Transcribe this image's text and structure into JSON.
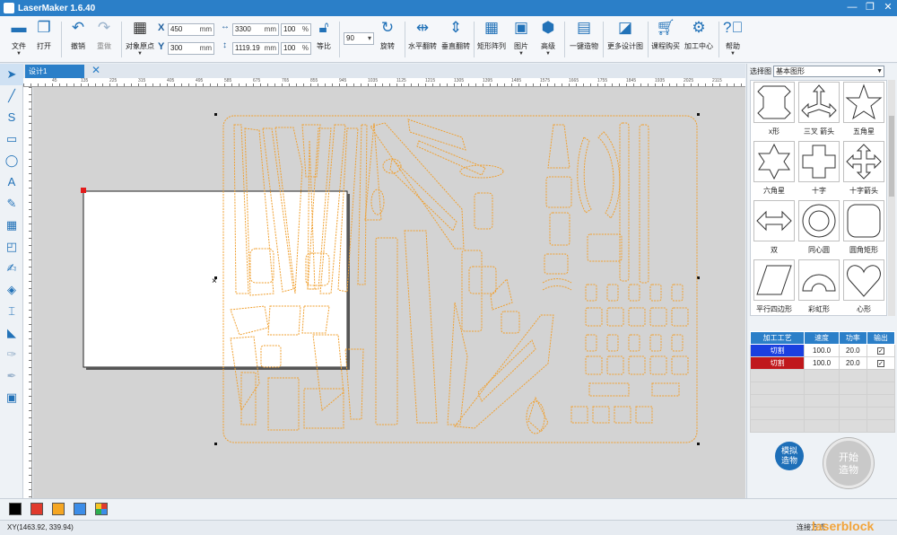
{
  "window": {
    "title": "LaserMaker 1.6.40",
    "controls": [
      "—",
      "❐",
      "✕"
    ]
  },
  "toolbar": {
    "file": "文件",
    "open": "打开",
    "undo": "撤销",
    "redo": "重做",
    "object_origin": "对象原点",
    "x_label": "X",
    "y_label": "Y",
    "x_value": "450",
    "y_value": "300",
    "width_value": "3300",
    "height_value": "1119.19",
    "unit_mm": "mm",
    "width_pct": "100",
    "height_pct": "100",
    "pct_unit": "%",
    "lock_ratio": "等比",
    "rotate_value": "90",
    "rotate": "旋转",
    "flip_h": "水平翻转",
    "flip_v": "垂直翻转",
    "matrix_array": "矩形阵列",
    "image": "图片",
    "advanced": "高级",
    "one_click": "一键造物",
    "more_designs": "更多设计图",
    "course_shop": "课程购买",
    "processing_center": "加工中心",
    "help": "帮助"
  },
  "tab": {
    "label": "设计1",
    "close": "✕"
  },
  "ruler": {
    "labels": [
      "45",
      "135",
      "225",
      "315",
      "405",
      "495",
      "585",
      "675",
      "765",
      "855",
      "945",
      "1035",
      "1125",
      "1215",
      "1305",
      "1395",
      "1485",
      "1575",
      "1665",
      "1755",
      "1845",
      "1935",
      "2025",
      "2115"
    ]
  },
  "panel": {
    "select_label": "选择图",
    "select_value": "基本图形",
    "shapes": [
      "x形",
      "三叉 箭头",
      "五角星",
      "六角星",
      "十字",
      "十字箭头",
      "双",
      "同心圆",
      "圆角矩形",
      "平行四边形",
      "彩虹形",
      "心形"
    ]
  },
  "process_table": {
    "headers": [
      "加工工艺",
      "速度",
      "功率",
      "输出"
    ],
    "rows": [
      {
        "process": "切割",
        "speed": "100.0",
        "power": "20.0",
        "color": "#1a3fe0"
      },
      {
        "process": "切割",
        "speed": "100.0",
        "power": "20.0",
        "color": "#c0181c"
      }
    ]
  },
  "buttons": {
    "simulate": "模拟\n造物",
    "start": "开始\n造物"
  },
  "colors": [
    "#000000",
    "#e03a2d",
    "#f5a623",
    "#3c8de8",
    "palette"
  ],
  "status": {
    "coords": "XY(1463.92, 339.94)",
    "connection": "连接方式",
    "brand": "laserblock"
  },
  "accent": "#2b7fc8",
  "path_color": "#f0a030"
}
